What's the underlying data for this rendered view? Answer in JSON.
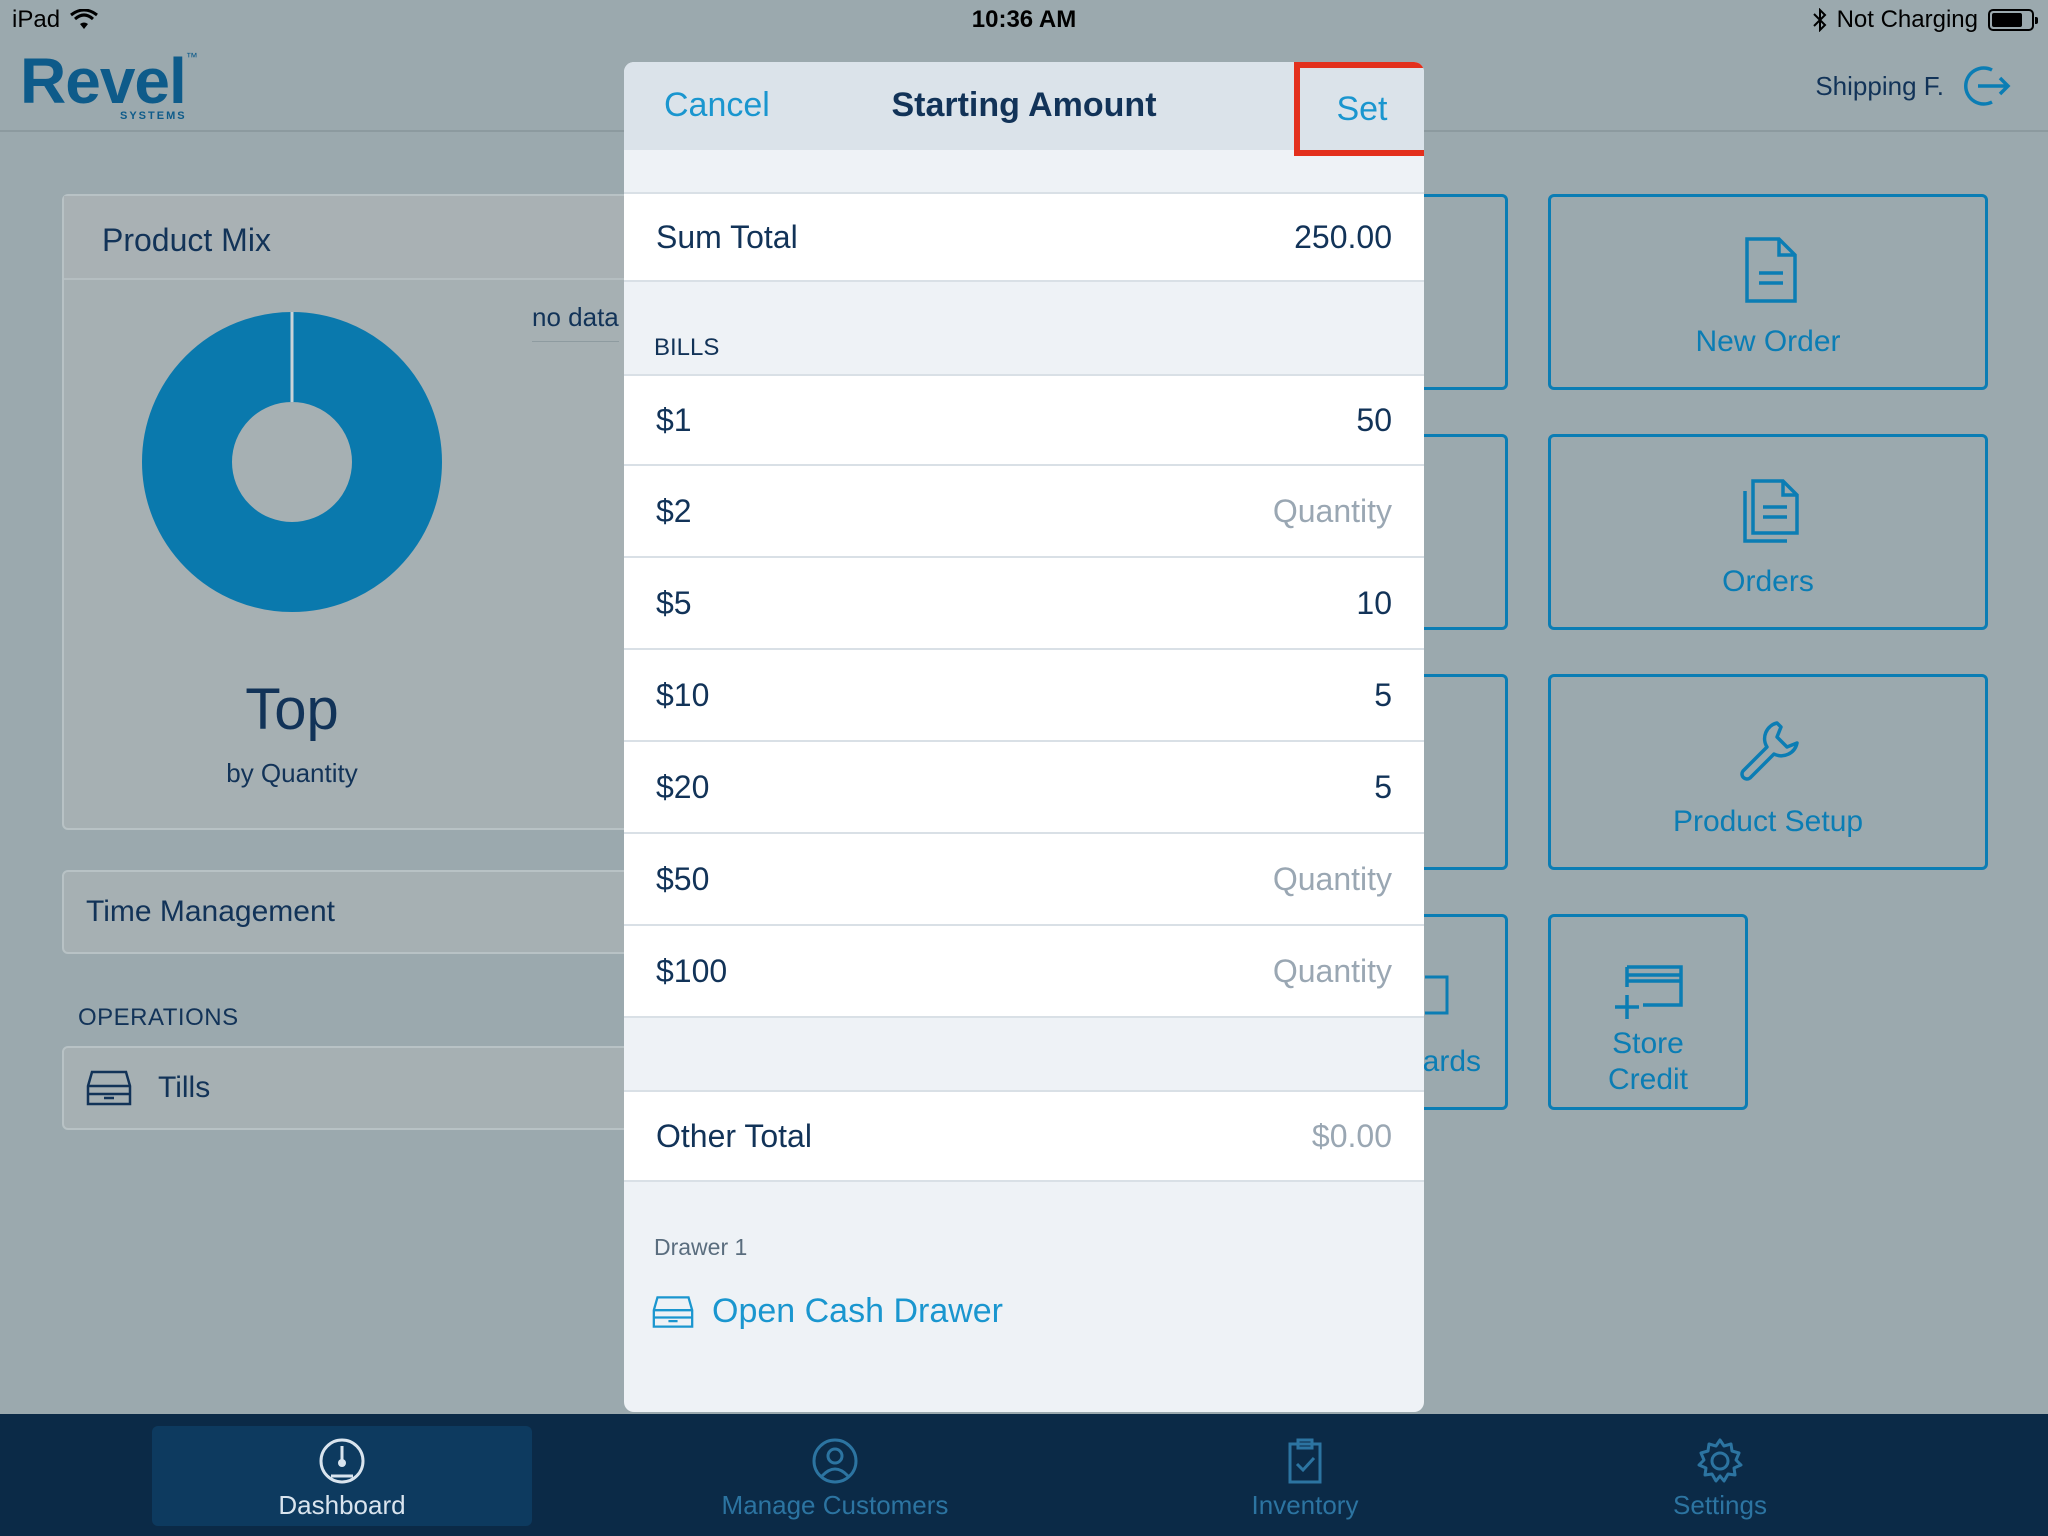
{
  "status_bar": {
    "device": "iPad",
    "time": "10:36 AM",
    "charging": "Not Charging"
  },
  "header": {
    "logo_text": "Revel",
    "logo_tm": "™",
    "logo_sub": "SYSTEMS",
    "user_name": "Shipping F."
  },
  "product_mix": {
    "title": "Product Mix",
    "no_data": "no data",
    "top_label": "Top",
    "by_label": "by Quantity",
    "donut_color": "#0a79ad"
  },
  "time_management": {
    "label": "Time Management"
  },
  "operations": {
    "section_label": "OPERATIONS",
    "tills_label": "Tills"
  },
  "tiles": {
    "new_order": "New Order",
    "orders": "Orders",
    "product_setup": "Product Setup",
    "store_credit_line1": "Store",
    "store_credit_line2": "Credit",
    "gift_cards_partial": "ards"
  },
  "modal": {
    "cancel_label": "Cancel",
    "title": "Starting Amount",
    "set_label": "Set",
    "sum_total_label": "Sum Total",
    "sum_total_value": "250.00",
    "bills_label": "BILLS",
    "bills": [
      {
        "denomination": "$1",
        "value": "50",
        "placeholder": false
      },
      {
        "denomination": "$2",
        "value": "Quantity",
        "placeholder": true
      },
      {
        "denomination": "$5",
        "value": "10",
        "placeholder": false
      },
      {
        "denomination": "$10",
        "value": "5",
        "placeholder": false
      },
      {
        "denomination": "$20",
        "value": "5",
        "placeholder": false
      },
      {
        "denomination": "$50",
        "value": "Quantity",
        "placeholder": true
      },
      {
        "denomination": "$100",
        "value": "Quantity",
        "placeholder": true
      }
    ],
    "other_total_label": "Other Total",
    "other_total_value": "$0.00",
    "drawer_label": "Drawer 1",
    "open_drawer_label": "Open Cash Drawer",
    "highlight_color": "#e3301d",
    "accent_color": "#1a96cf"
  },
  "tabbar": {
    "tabs": [
      {
        "label": "Dashboard",
        "icon": "gauge-icon",
        "active": true
      },
      {
        "label": "Manage Customers",
        "icon": "user-circle-icon",
        "active": false
      },
      {
        "label": "Inventory",
        "icon": "clipboard-check-icon",
        "active": false
      },
      {
        "label": "Settings",
        "icon": "gear-icon",
        "active": false
      }
    ]
  }
}
